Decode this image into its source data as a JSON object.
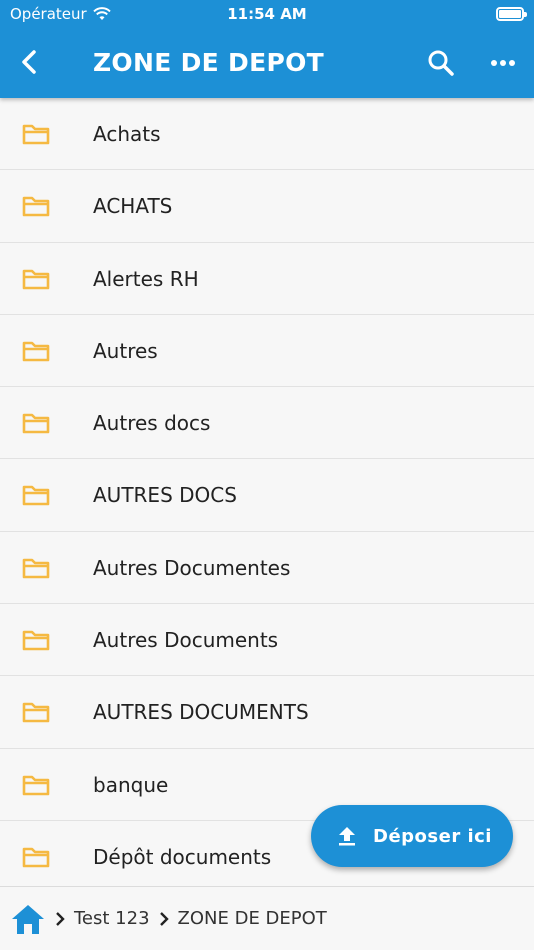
{
  "status_bar": {
    "carrier": "Opérateur",
    "time": "11:54 AM"
  },
  "header": {
    "title": "ZONE DE DEPOT"
  },
  "folders": [
    {
      "name": "Achats"
    },
    {
      "name": "ACHATS"
    },
    {
      "name": "Alertes RH"
    },
    {
      "name": "Autres"
    },
    {
      "name": "Autres docs"
    },
    {
      "name": "AUTRES DOCS"
    },
    {
      "name": "Autres Documentes"
    },
    {
      "name": "Autres Documents"
    },
    {
      "name": "AUTRES DOCUMENTS"
    },
    {
      "name": "banque"
    },
    {
      "name": "Dépôt documents"
    }
  ],
  "upload_button": {
    "label": "Déposer ici"
  },
  "breadcrumb": {
    "items": [
      "Test 123",
      "ZONE DE DEPOT"
    ]
  },
  "colors": {
    "primary": "#1d90d6",
    "folder": "#f5b942"
  }
}
